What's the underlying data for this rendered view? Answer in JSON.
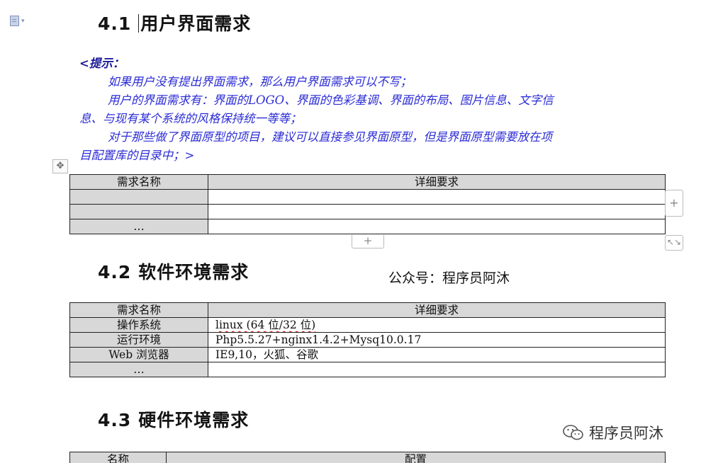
{
  "section_4_1": {
    "number": "4.1",
    "title": "用户界面需求"
  },
  "hint": {
    "title": "<提示：",
    "lines": [
      "如果用户没有提出界面需求，那么用户界面需求可以不写；",
      "用户的界面需求有：界面的LOGO、界面的色彩基调、界面的布局、图片信息、文字信",
      "息、与现有某个系统的风格保持统一等等；",
      "对于那些做了界面原型的项目，建议可以直接参见界面原型，但是界面原型需要放在项",
      "目配置库的目录中；>"
    ]
  },
  "table_ui": {
    "headers": [
      "需求名称",
      "详细要求"
    ],
    "rows": [
      [
        "",
        ""
      ],
      [
        "",
        ""
      ],
      [
        "…",
        ""
      ]
    ]
  },
  "section_4_2": {
    "number": "4.2",
    "title": "软件环境需求"
  },
  "overlay_text": "公众号：程序员阿沐",
  "table_software": {
    "headers": [
      "需求名称",
      "详细要求"
    ],
    "rows": [
      [
        "操作系统",
        "linux (64 位/32 位)"
      ],
      [
        "运行环境",
        "Php5.5.27+nginx1.4.2+Mysq10.0.17"
      ],
      [
        "Web 浏览器",
        "IE9,10，火狐、谷歌"
      ],
      [
        "…",
        ""
      ]
    ]
  },
  "section_4_3": {
    "number": "4.3",
    "title": "硬件环境需求"
  },
  "table_hardware": {
    "headers": [
      "名称",
      "配置"
    ]
  },
  "watermark": {
    "text": "程序员阿沐",
    "icon": "wechat-icon"
  },
  "table_controls": {
    "add_column": "+",
    "add_row": "+",
    "resize": "↖↘",
    "move": "✥"
  }
}
